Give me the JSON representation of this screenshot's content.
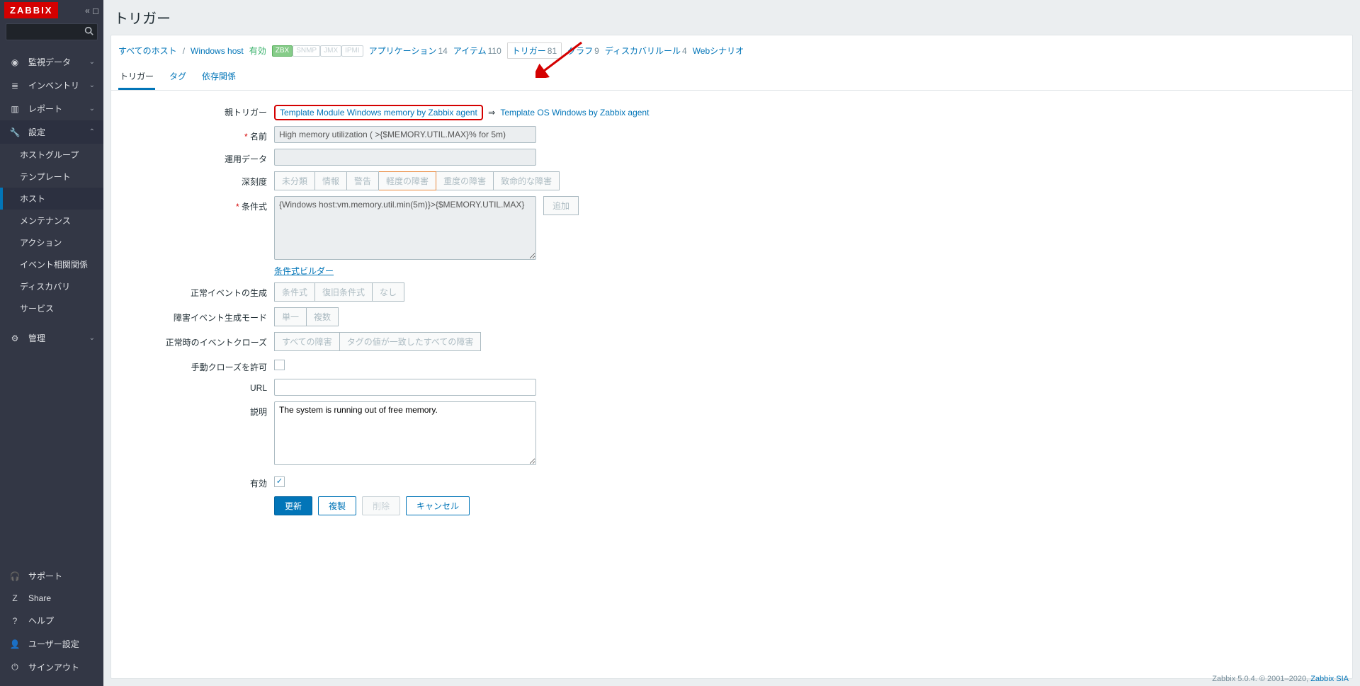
{
  "logo": "ZABBIX",
  "sidebar": {
    "monitoring": "監視データ",
    "inventory": "インベントリ",
    "reports": "レポート",
    "config": "設定",
    "config_items": [
      "ホストグループ",
      "テンプレート",
      "ホスト",
      "メンテナンス",
      "アクション",
      "イベント相関関係",
      "ディスカバリ",
      "サービス"
    ],
    "admin": "管理",
    "support": "サポート",
    "share": "Share",
    "help": "ヘルプ",
    "user": "ユーザー設定",
    "logout": "サインアウト"
  },
  "page_title": "トリガー",
  "breadcrumb": {
    "all_hosts": "すべてのホスト",
    "host": "Windows host",
    "enabled": "有効",
    "zbx": "ZBX",
    "snmp": "SNMP",
    "jmx": "JMX",
    "ipmi": "IPMI",
    "apps": "アプリケーション",
    "apps_n": "14",
    "items": "アイテム",
    "items_n": "110",
    "triggers": "トリガー",
    "triggers_n": "81",
    "graphs": "グラフ",
    "graphs_n": "9",
    "disc": "ディスカバリルール",
    "disc_n": "4",
    "web": "Webシナリオ"
  },
  "tabs": {
    "trigger": "トリガー",
    "tags": "タグ",
    "deps": "依存関係"
  },
  "form": {
    "parent_label": "親トリガー",
    "parent1": "Template Module Windows memory by Zabbix agent",
    "parent_arrow": "⇒",
    "parent2": "Template OS Windows by Zabbix agent",
    "name_label": "名前",
    "name_value": "High memory utilization ( >{$MEMORY.UTIL.MAX}% for 5m)",
    "opdata_label": "運用データ",
    "sev_label": "深刻度",
    "sev": [
      "未分類",
      "情報",
      "警告",
      "軽度の障害",
      "重度の障害",
      "致命的な障害"
    ],
    "expr_label": "条件式",
    "expr_value": "{Windows host:vm.memory.util.min(5m)}>{$MEMORY.UTIL.MAX}",
    "add_btn": "追加",
    "expr_builder": "条件式ビルダー",
    "ok_gen_label": "正常イベントの生成",
    "ok_gen": [
      "条件式",
      "復旧条件式",
      "なし"
    ],
    "prob_mode_label": "障害イベント生成モード",
    "prob_mode": [
      "単一",
      "複数"
    ],
    "ok_close_label": "正常時のイベントクローズ",
    "ok_close": [
      "すべての障害",
      "タグの値が一致したすべての障害"
    ],
    "manual_label": "手動クローズを許可",
    "url_label": "URL",
    "desc_label": "説明",
    "desc_value": "The system is running out of free memory.",
    "enabled_label": "有効"
  },
  "actions": {
    "update": "更新",
    "clone": "複製",
    "delete": "削除",
    "cancel": "キャンセル"
  },
  "footer": {
    "text": "Zabbix 5.0.4. © 2001–2020, ",
    "link": "Zabbix SIA"
  }
}
